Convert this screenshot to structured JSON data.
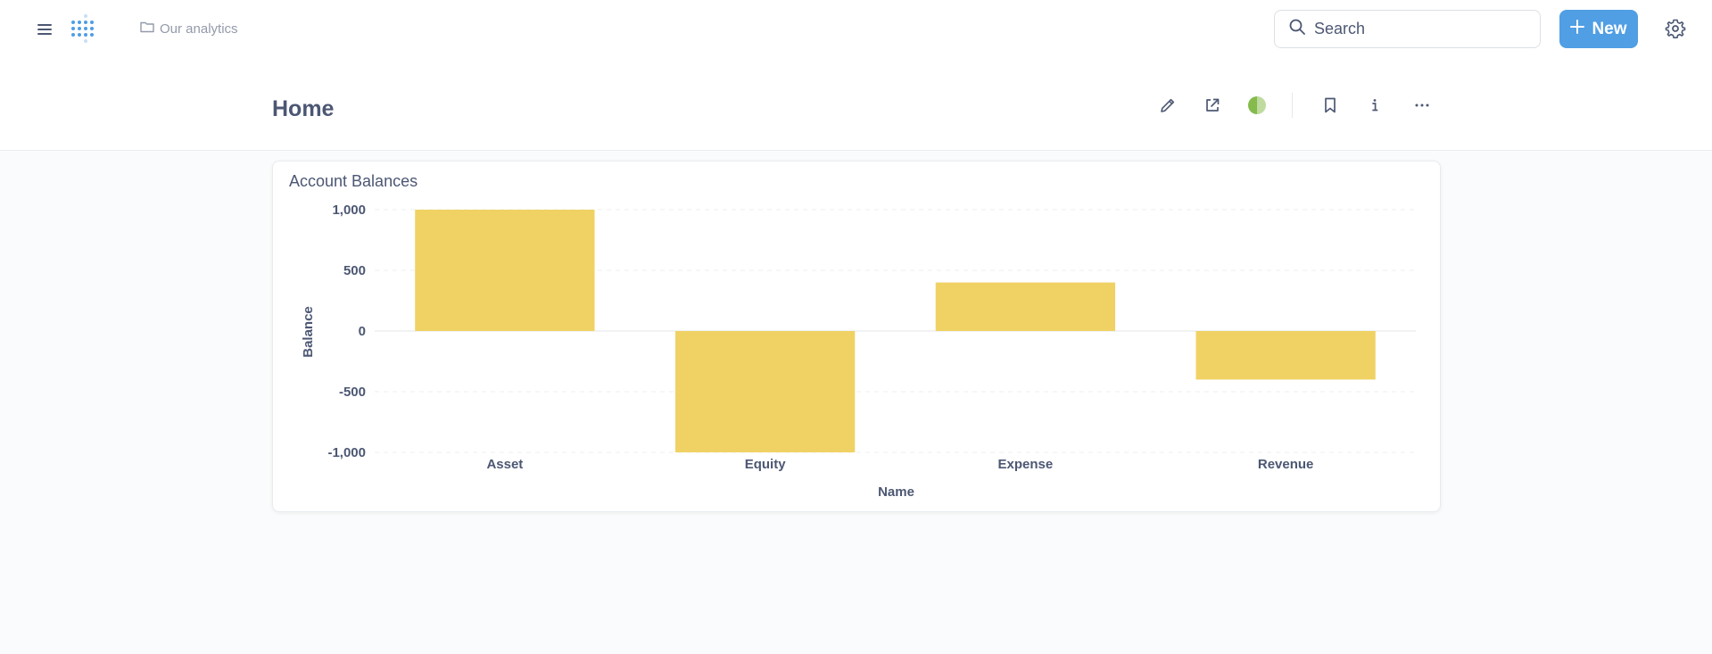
{
  "topbar": {
    "breadcrumb": "Our analytics",
    "search_placeholder": "Search",
    "new_label": "New"
  },
  "page": {
    "title": "Home"
  },
  "colors": {
    "accent": "#509ee3",
    "bar": "#f0d264",
    "status_green": "#84bb4c"
  },
  "icons": {
    "menu": "hamburger-icon",
    "logo": "metabase-logo",
    "folder": "folder-icon",
    "search": "search-icon",
    "plus": "plus-icon",
    "settings": "gear-icon",
    "edit": "pencil-icon",
    "share": "share-icon",
    "theme": "half-circle-icon",
    "bookmark": "bookmark-icon",
    "info": "info-icon",
    "more": "ellipsis-icon"
  },
  "card": {
    "title": "Account Balances"
  },
  "chart_data": {
    "type": "bar",
    "title": "Account Balances",
    "categories": [
      "Asset",
      "Equity",
      "Expense",
      "Revenue"
    ],
    "values": [
      1000,
      -1000,
      400,
      -400
    ],
    "xlabel": "Name",
    "ylabel": "Balance",
    "ylim": [
      -1000,
      1000
    ],
    "yticks": [
      1000,
      500,
      0,
      -500,
      -1000
    ],
    "ytick_labels": [
      "1,000",
      "500",
      "0",
      "-500",
      "-1,000"
    ],
    "grid": true
  }
}
